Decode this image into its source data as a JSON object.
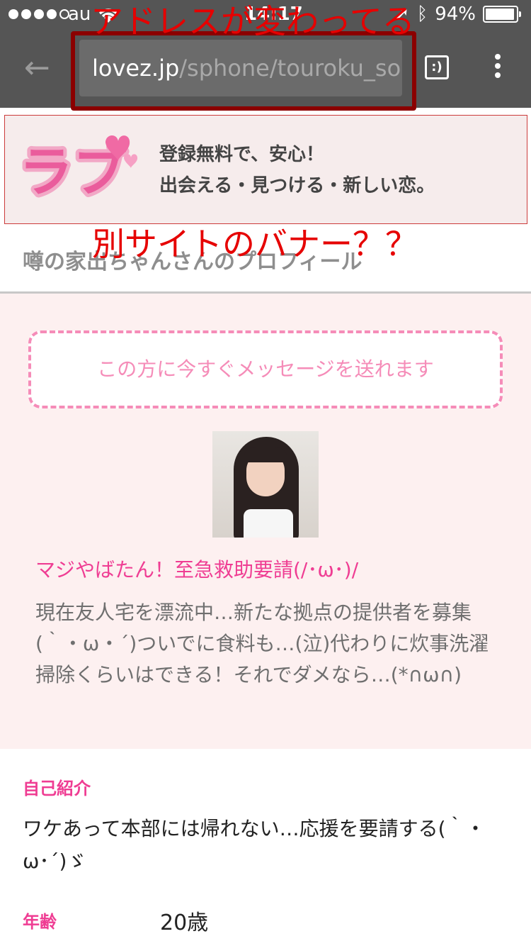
{
  "status_bar": {
    "carrier": "au",
    "time": "14:17",
    "battery": "94%",
    "signal_bars": 4
  },
  "browser": {
    "url_domain": "lovez.jp",
    "url_path": "/sphone/touroku_sous",
    "tab_icon_label": ":)",
    "highlight_color": "#8b0000"
  },
  "annotations": {
    "top": "アドレスが変わってる",
    "middle": "別サイトのバナー？？",
    "color": "#e60000"
  },
  "banner": {
    "logo_text": "ラブ",
    "line1": "登録無料で、安心！",
    "line2": "出会える・見つける・新しい恋。"
  },
  "profile": {
    "title": "噂の家出ちゃんさんのプロフィール",
    "message_button": "この方に今すぐメッセージを送れます",
    "headline": "マジやばたん！至急救助要請(/･ω･)/",
    "description": "現在友人宅を漂流中…新たな拠点の提供者を募集(｀・ω・´)ついでに食料も…(泣)代わりに炊事洗濯掃除くらいはできる！それでダメなら…(*∩ω∩)"
  },
  "details": {
    "intro_label": "自己紹介",
    "intro_text": "ワケあって本部には帰れない…応援を要請する(｀・ω･´)ゞ",
    "age_label": "年齢",
    "age_value": "20歳"
  },
  "colors": {
    "accent_pink": "#ef3d93",
    "toolbar": "#555555",
    "card_bg": "#fdf0f0"
  }
}
